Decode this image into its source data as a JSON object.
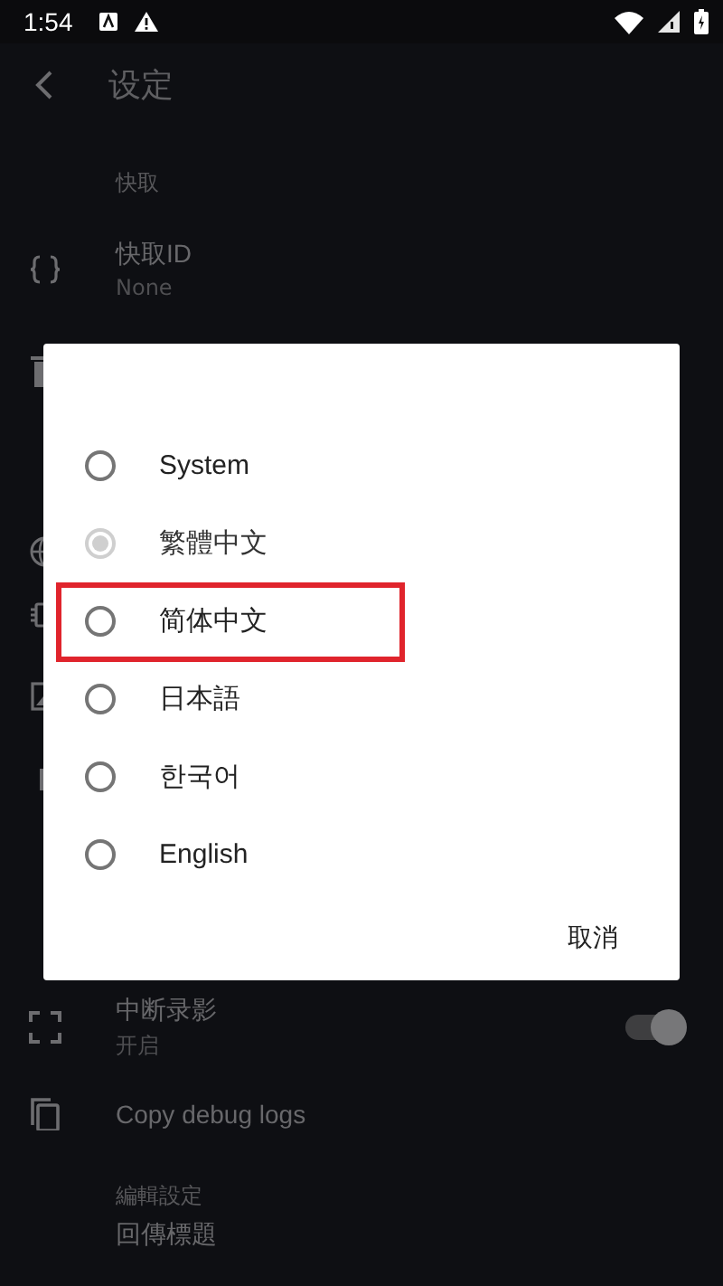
{
  "status_bar": {
    "time": "1:54"
  },
  "toolbar": {
    "title": "设定"
  },
  "sections": [
    {
      "header": "快取",
      "rows": [
        {
          "kind": "info",
          "title": "快取ID",
          "subtitle": "None"
        }
      ]
    },
    {
      "rows": [
        {
          "kind": "toggle",
          "title": "中断录影",
          "subtitle": "开启",
          "on": true
        },
        {
          "kind": "action",
          "title": "Copy debug logs"
        }
      ]
    },
    {
      "header": "編輯設定",
      "rows": [
        {
          "kind": "action",
          "title": "回傳標題"
        }
      ]
    }
  ],
  "dialog": {
    "options": [
      {
        "label": "System",
        "selected": false,
        "disabled": false,
        "highlighted": false
      },
      {
        "label": "繁體中文",
        "selected": true,
        "disabled": true,
        "highlighted": false
      },
      {
        "label": "简体中文",
        "selected": false,
        "disabled": false,
        "highlighted": true
      },
      {
        "label": "日本語",
        "selected": false,
        "disabled": false,
        "highlighted": false
      },
      {
        "label": "한국어",
        "selected": false,
        "disabled": false,
        "highlighted": false
      },
      {
        "label": "English",
        "selected": false,
        "disabled": false,
        "highlighted": false
      }
    ],
    "buttons": [
      "取消"
    ]
  }
}
